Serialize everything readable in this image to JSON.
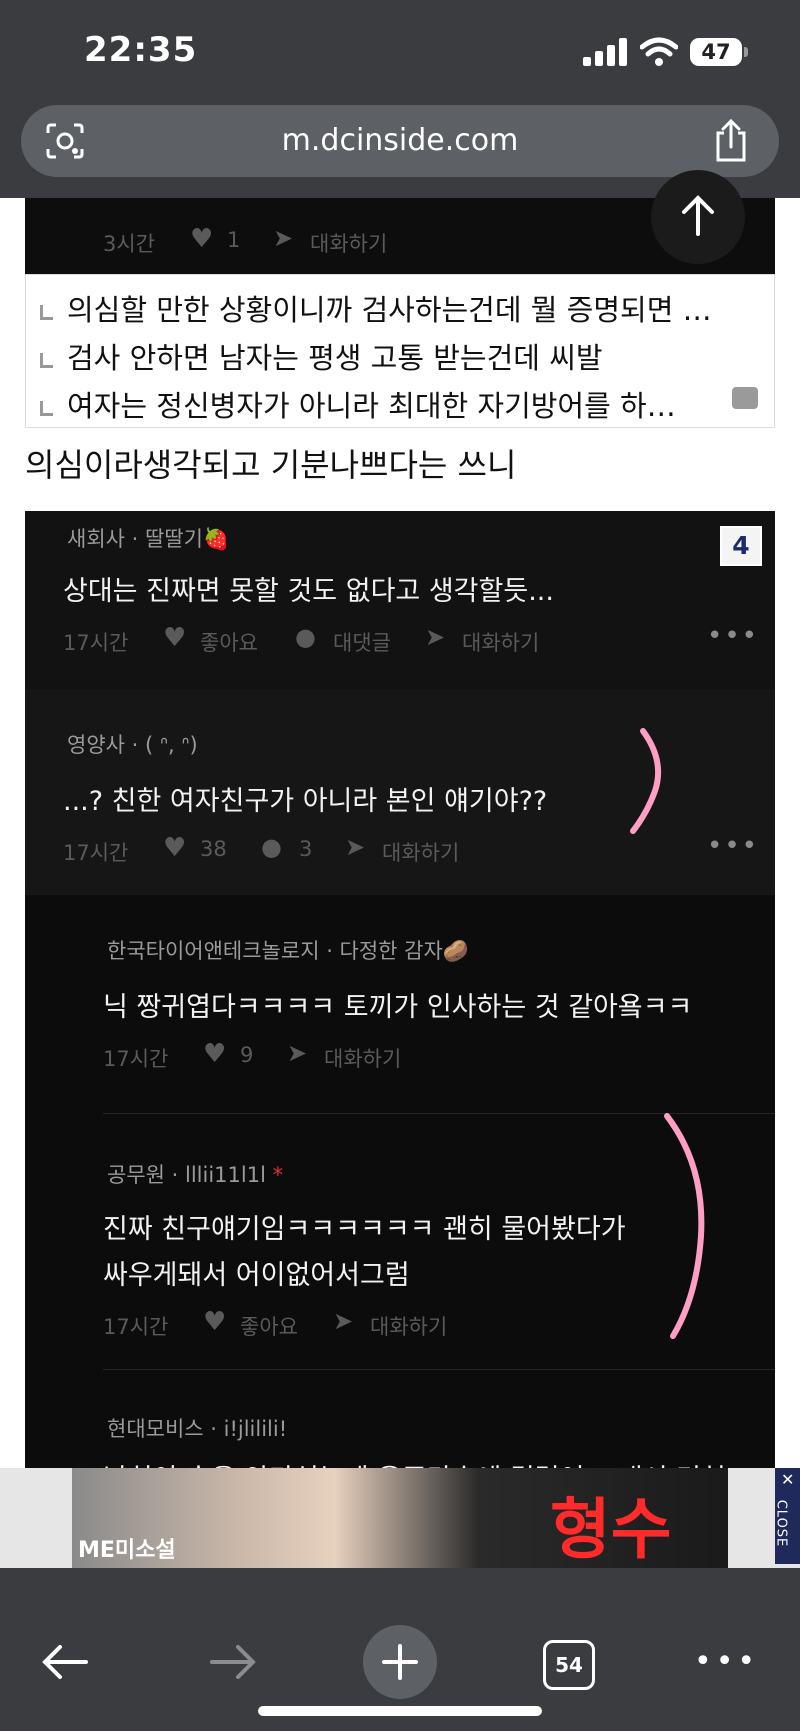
{
  "status_bar": {
    "time": "22:35",
    "battery": "47"
  },
  "browser": {
    "url": "m.dcinside.com",
    "tab_count": "54"
  },
  "top_comment": {
    "time": "3시간",
    "likes": "1",
    "reply_action": "대화하기"
  },
  "reply_previews": [
    {
      "text": "의심할 만한 상황이니까 검사하는건데 뭘 증명되면 …"
    },
    {
      "text": "검사 안하면 남자는 평생 고통 받는건데 씨발"
    },
    {
      "text": "여자는 정신병자가 아니라 최대한 자기방어를 하…"
    }
  ],
  "post_text": "의심이라생각되고  기분나쁘다는 쓰니",
  "image_index": "4",
  "comments": [
    {
      "author": "새회사 · 딸딸기",
      "badge": "🍓",
      "text": "상대는 진짜면 못할 것도 없다고 생각할듯...",
      "time": "17시간",
      "likes": "좋아요",
      "replies": "대댓글",
      "action": "대화하기"
    },
    {
      "author": "영양사 · ( ᐢ, ᐢ)",
      "text": "...? 친한 여자친구가 아니라 본인 얘기야??",
      "time": "17시간",
      "likes": "38",
      "replies": "3",
      "action": "대화하기"
    }
  ],
  "replies": [
    {
      "author": "한국타이어앤테크놀로지 · 다정한 감자",
      "badge": "🥔",
      "text": "닉 짱귀엽다ㅋㅋㅋㅋ 토끼가 인사하는 것 같아욬ㅋㅋ",
      "time": "17시간",
      "likes": "9",
      "action": "대화하기"
    },
    {
      "author": "공무원 · lllii11l1l",
      "mark": "*",
      "text_line1": "진짜 친구얘기임ㅋㅋㅋㅋㅋㅋ 괜히 물어봤다가",
      "text_line2": "싸우게돼서 어이없어서그럼",
      "time": "17시간",
      "likes": "좋아요",
      "action": "대화하기"
    },
    {
      "author": "현대모비스 · i!jlilili!",
      "text": "남친이 술을 안마셨는데 음주단속에 걸렸어 그래서 면허"
    }
  ],
  "ad": {
    "brand": "ME미소설",
    "title": "형수",
    "close_label": "CLOSE"
  }
}
